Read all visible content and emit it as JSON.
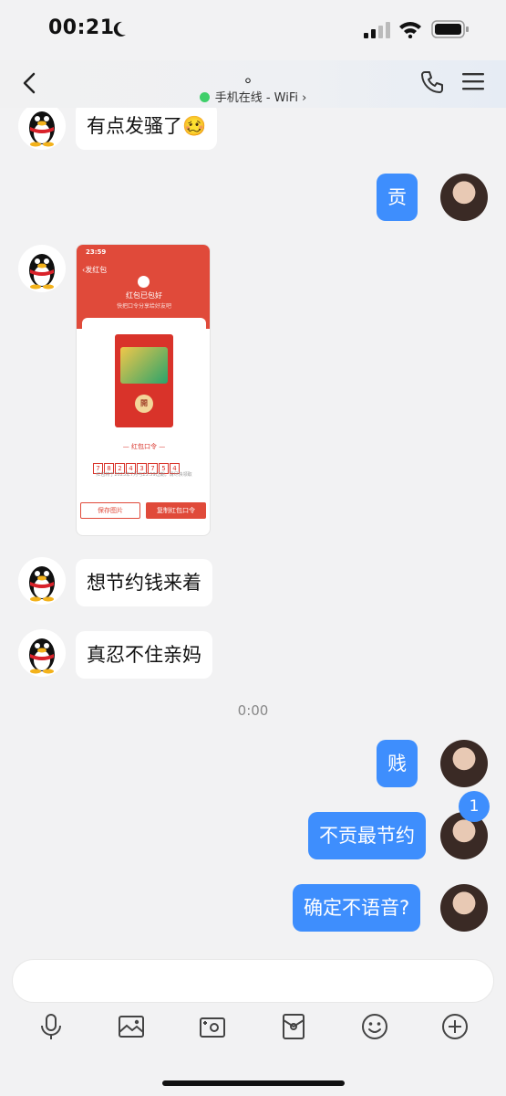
{
  "status_bar": {
    "time": "00:21"
  },
  "nav": {
    "title": "。",
    "online_status": "手机在线 - WiFi ›"
  },
  "messages": [
    {
      "side": "left",
      "text": "有点发骚了🥴"
    },
    {
      "side": "right",
      "text": "贡"
    },
    {
      "side": "left",
      "type": "image"
    },
    {
      "side": "left",
      "text": "想节约钱来着"
    },
    {
      "side": "left",
      "text": "真忍不住亲妈"
    },
    {
      "side": "right",
      "text": "贱"
    },
    {
      "side": "right",
      "text": "不贡最节约"
    },
    {
      "side": "right",
      "text": "确定不语音?"
    }
  ],
  "timestamp": "0:00",
  "image_card": {
    "time": "23:59",
    "back_label": "‹发红包",
    "title": "红包已包好",
    "subtitle": "快把口令分享给好友吧",
    "seal": "開",
    "code_label": "— 红包口令 —",
    "code_digits": [
      "7",
      "8",
      "2",
      "4",
      "3",
      "7",
      "5",
      "4"
    ],
    "code_note": "红包将于2023年7月与23:59过期，请尽快领取",
    "save_button": "保存图片",
    "copy_button": "复制红包口令"
  },
  "unread_count": "1",
  "toolbar": [
    "mic-icon",
    "image-icon",
    "camera-icon",
    "red-packet-icon",
    "emoji-icon",
    "plus-icon"
  ]
}
